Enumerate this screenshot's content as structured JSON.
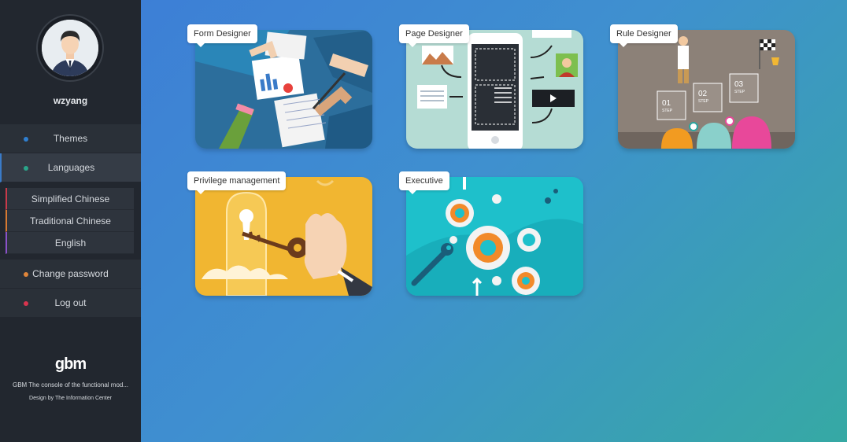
{
  "user": {
    "name": "wzyang"
  },
  "menu": {
    "themes": "Themes",
    "languages": "Languages",
    "languages_sub": [
      "Simplified Chinese",
      "Traditional Chinese",
      "English"
    ],
    "change_password": "Change password",
    "logout": "Log out"
  },
  "colors": {
    "themes_dot": "#2f7fd0",
    "languages_dot": "#2aa58a",
    "change_password_dot": "#e0853a",
    "logout_dot": "#d8344e",
    "sub_borders": [
      "#c93a4a",
      "#d77a32",
      "#8a52c9"
    ]
  },
  "brand": {
    "logo": "gbm",
    "description": "GBM The console of the functional mod...",
    "credit": "Design by The Information Center"
  },
  "cards": [
    {
      "label": "Form Designer"
    },
    {
      "label": "Page Designer"
    },
    {
      "label": "Rule Designer"
    },
    {
      "label": "Privilege management"
    },
    {
      "label": "Executive"
    }
  ],
  "card_images": {
    "rule_steps": [
      "01",
      "02",
      "03"
    ],
    "step_word": "STEP"
  }
}
